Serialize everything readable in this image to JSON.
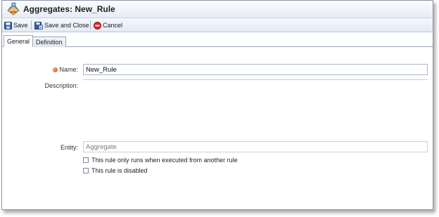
{
  "window": {
    "title": "Aggregates: New_Rule",
    "icon": "aggregates-app-icon"
  },
  "toolbar": {
    "save_label": "Save",
    "save_close_label": "Save and Close",
    "cancel_label": "Cancel"
  },
  "tabs": [
    {
      "label": "General",
      "active": true
    },
    {
      "label": "Definition",
      "active": false
    }
  ],
  "form": {
    "name_label": "Name:",
    "name_value": "New_Rule",
    "name_required": true,
    "description_label": "Description:",
    "description_value": "",
    "entity_label": "Entity:",
    "entity_value": "Aggregate",
    "checkbox_called_only_label": "This rule only runs when executed from another rule",
    "checkbox_called_only_checked": false,
    "checkbox_disabled_label": "This rule is disabled",
    "checkbox_disabled_checked": false
  },
  "colors": {
    "required_indicator": "#d9531e",
    "cancel_icon": "#d42a2a",
    "save_icon": "#2f5fa8"
  }
}
